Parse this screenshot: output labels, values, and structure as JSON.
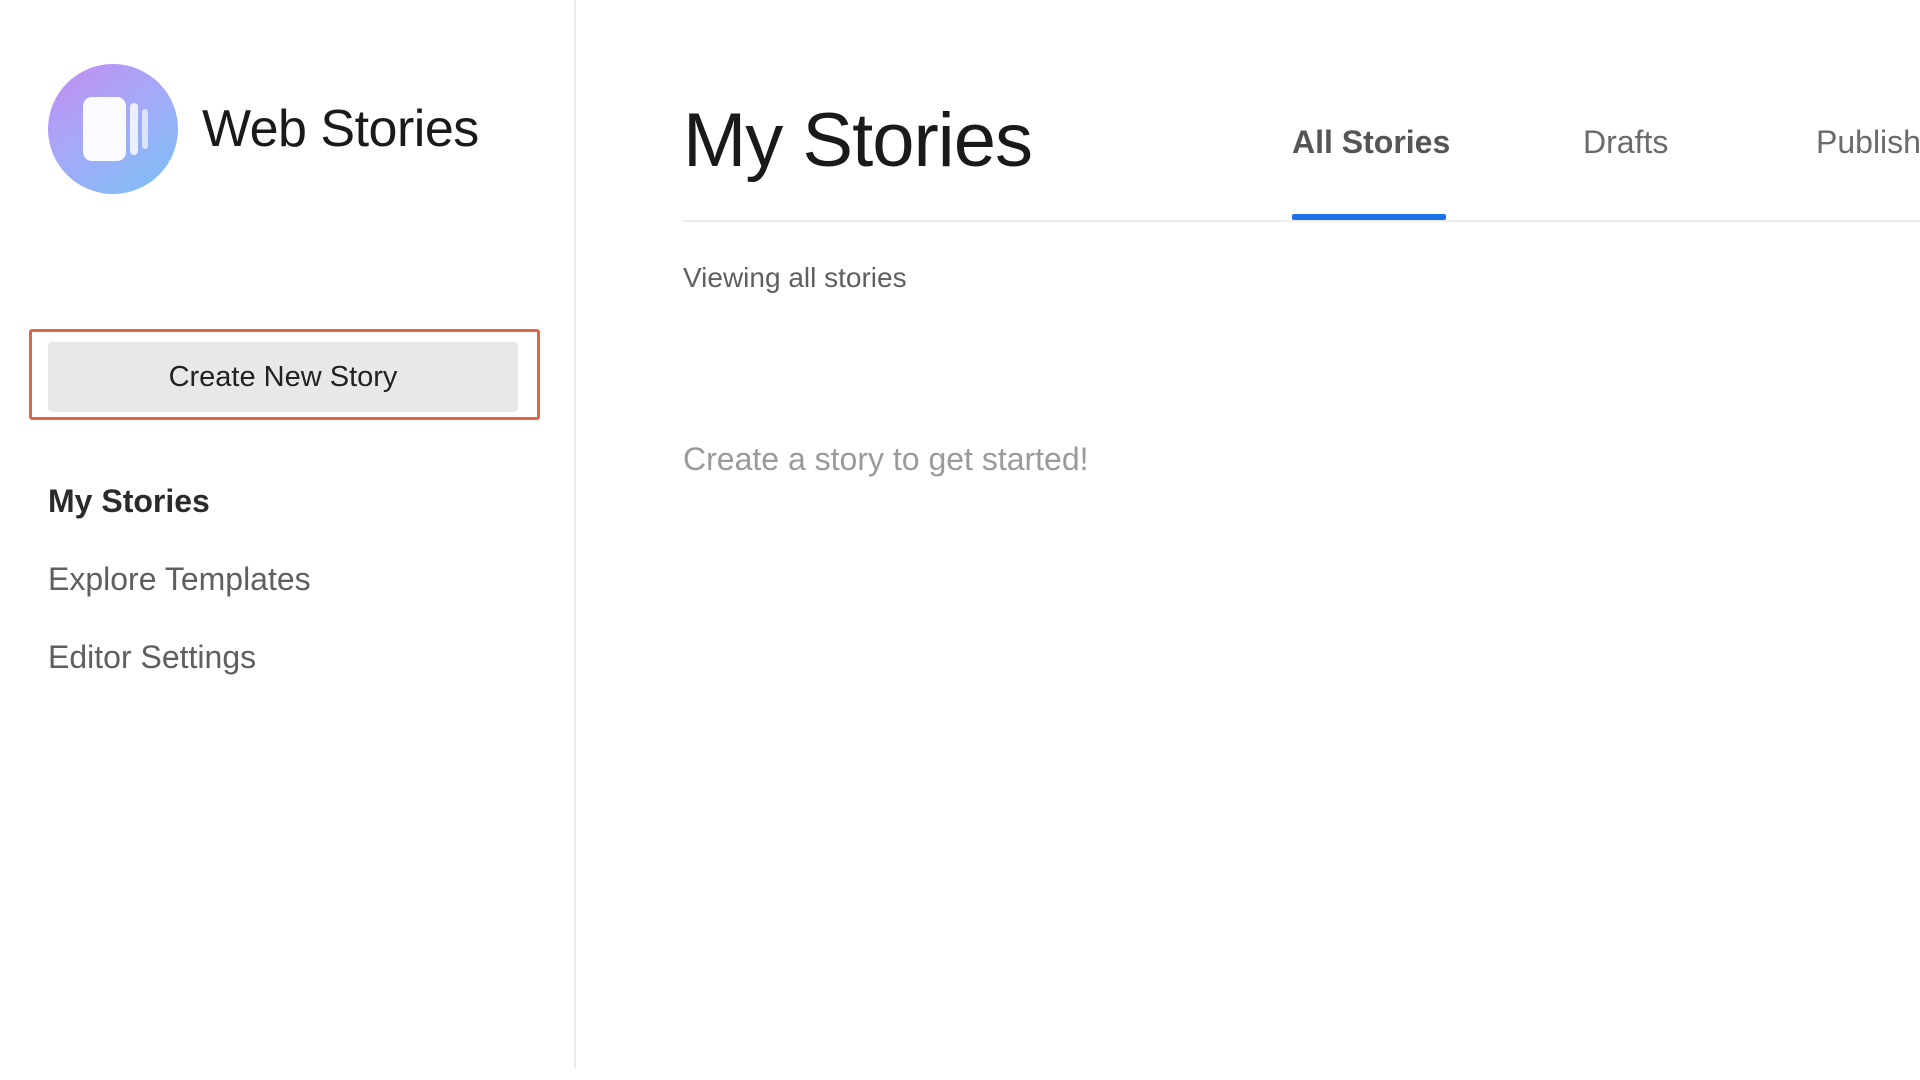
{
  "sidebar": {
    "brand": {
      "name": "Web Stories",
      "logo_icon": "web-stories-logo-icon"
    },
    "create_button_label": "Create New Story",
    "nav_items": [
      {
        "label": "My Stories",
        "active": true
      },
      {
        "label": "Explore Templates",
        "active": false
      },
      {
        "label": "Editor Settings",
        "active": false
      }
    ]
  },
  "main": {
    "title": "My Stories",
    "tabs": [
      {
        "label": "All Stories",
        "active": true
      },
      {
        "label": "Drafts",
        "active": false
      },
      {
        "label": "Publish",
        "active": false
      }
    ],
    "viewing_label": "Viewing all stories",
    "empty_message": "Create a story to get started!"
  },
  "colors": {
    "accent": "#1a73e8",
    "highlight_outline": "#e0673f",
    "button_bg": "#e8e8e8",
    "logo_gradient": [
      "#c38bf2",
      "#79c1f6"
    ]
  }
}
